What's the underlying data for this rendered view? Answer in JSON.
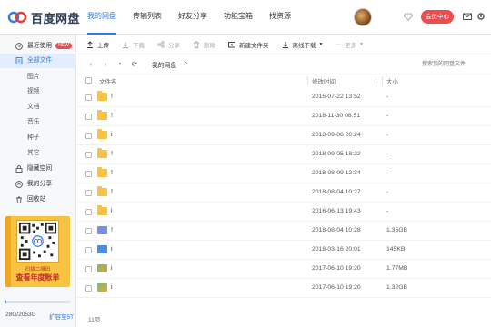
{
  "header": {
    "logo_text": "百度网盘",
    "tabs": [
      {
        "label": "我的网盘",
        "active": true
      },
      {
        "label": "传输列表",
        "active": false
      },
      {
        "label": "好友分享",
        "active": false
      },
      {
        "label": "功能宝箱",
        "active": false
      },
      {
        "label": "找资源",
        "active": false
      }
    ],
    "member_button": "会员中心",
    "accent_color": "#2f7ee8",
    "member_color": "#f04b4b"
  },
  "sidebar": {
    "items": [
      {
        "label": "最近使用",
        "badge": "NEW",
        "icon": "clock-icon"
      },
      {
        "label": "全部文件",
        "icon": "files-icon",
        "active": true
      },
      {
        "label": "图片",
        "sub": true
      },
      {
        "label": "视频",
        "sub": true
      },
      {
        "label": "文档",
        "sub": true
      },
      {
        "label": "音乐",
        "sub": true
      },
      {
        "label": "种子",
        "sub": true
      },
      {
        "label": "其它",
        "sub": true
      },
      {
        "label": "隐藏空间",
        "icon": "lock-icon"
      },
      {
        "label": "我的分享",
        "icon": "share-icon"
      },
      {
        "label": "回收站",
        "icon": "trash-icon"
      }
    ],
    "promo": {
      "line1": "扫描二维码",
      "line2": "查看年度账单"
    },
    "storage": {
      "text": "28G/2053G",
      "expand_label": "扩容至5T",
      "used_fraction": 0.014
    }
  },
  "toolbar": {
    "upload": "上传",
    "download": "下载",
    "share": "分享",
    "delete": "删除",
    "new_folder": "新建文件夹",
    "offline_download": "离线下载",
    "more": "更多"
  },
  "breadcrumb": {
    "path": "我的网盘",
    "separator": ">",
    "search_placeholder": "搜索我的网盘文件"
  },
  "table": {
    "headers": {
      "name": "文件名",
      "time": "修改时间",
      "size": "大小"
    },
    "rows": [
      {
        "type": "folder",
        "name": "!",
        "time": "2015-07-22 13:52",
        "size": "-"
      },
      {
        "type": "folder",
        "name": "!",
        "time": "2018-11-30 08:51",
        "size": "-"
      },
      {
        "type": "folder",
        "name": "i",
        "time": "2018-09-06 20:24",
        "size": "-"
      },
      {
        "type": "folder",
        "name": "!",
        "time": "2018-09-05 18:22",
        "size": "-"
      },
      {
        "type": "folder",
        "name": "!",
        "time": "2018-08-09 12:34",
        "size": "-"
      },
      {
        "type": "folder",
        "name": "!",
        "time": "2018-08-04 10:27",
        "size": "-"
      },
      {
        "type": "folder",
        "name": "i",
        "time": "2016-06-13 19:43",
        "size": "-"
      },
      {
        "type": "video",
        "name": "!",
        "time": "2018-08-04 10:28",
        "size": "1.35GB"
      },
      {
        "type": "doc",
        "name": "i",
        "time": "2018-03-16 20:01",
        "size": "145KB"
      },
      {
        "type": "img",
        "name": "i",
        "time": "2017-06-10 19:20",
        "size": "1.77MB"
      },
      {
        "type": "img",
        "name": "i",
        "time": "2017-06-10 19:20",
        "size": "1.32GB"
      }
    ],
    "footer_count": "11项"
  }
}
